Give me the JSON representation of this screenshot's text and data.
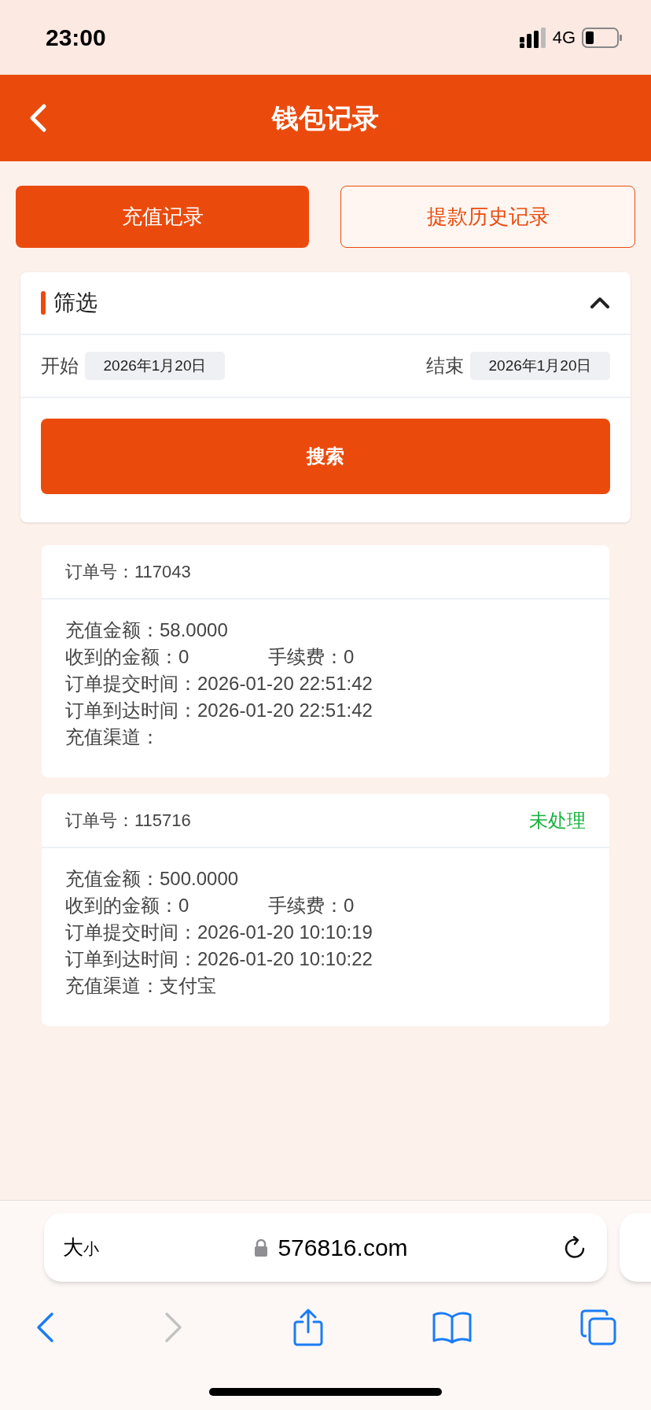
{
  "status_bar": {
    "time": "23:00",
    "network": "4G"
  },
  "header": {
    "title": "钱包记录"
  },
  "tabs": [
    {
      "label": "充值记录",
      "selected": true
    },
    {
      "label": "提款历史记录",
      "selected": false
    }
  ],
  "filter": {
    "title": "筛选",
    "expanded": true,
    "start_label": "开始",
    "start_date": "2026年1月20日",
    "end_label": "结束",
    "end_date": "2026年1月20日",
    "search_button": "搜索"
  },
  "records": [
    {
      "order_label": "订单号：",
      "order_no": "117043",
      "lines": [
        [
          {
            "label": "充值金额：",
            "value": "58.0000"
          }
        ],
        [
          {
            "label": "收到的金额：",
            "value": "0"
          },
          {
            "label": "手续费：",
            "value": "0"
          }
        ],
        [
          {
            "label": "订单提交时间：",
            "value": "2026-01-20 22:51:42"
          }
        ],
        [
          {
            "label": "订单到达时间：",
            "value": "2026-01-20 22:51:42"
          }
        ],
        [
          {
            "label": "充值渠道："
          }
        ]
      ]
    },
    {
      "order_label": "订单号：",
      "order_no": "115716",
      "status": "未处理",
      "lines": [
        [
          {
            "label": "充值金额：",
            "value": "500.0000"
          }
        ],
        [
          {
            "label": "收到的金额：",
            "value": "0"
          },
          {
            "label": "手续费：",
            "value": "0"
          }
        ],
        [
          {
            "label": "订单提交时间：",
            "value": "2026-01-20 10:10:19"
          }
        ],
        [
          {
            "label": "订单到达时间：",
            "value": "2026-01-20 10:10:22"
          }
        ],
        [
          {
            "label": "充值渠道：",
            "value": "支付宝"
          }
        ]
      ]
    }
  ],
  "browser": {
    "text_size": "大小",
    "url": "576816.com"
  }
}
